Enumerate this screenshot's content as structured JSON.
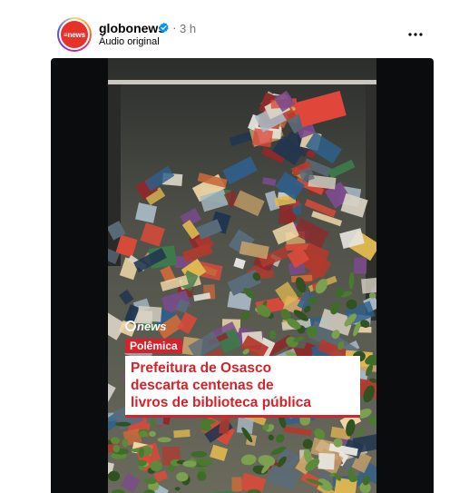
{
  "post": {
    "username": "globonews",
    "time_separator": "·",
    "time": "3 h",
    "audio_label": "Áudio original",
    "avatar_text": "≡news",
    "more_icon": "more-horizontal-icon",
    "verified_icon": "verified-badge-icon"
  },
  "video": {
    "brand_logo": "news",
    "tag": "Polêmica",
    "headline": "Prefeitura de Osasco\ndescarta centenas de\nlivros de biblioteca pública"
  },
  "colors": {
    "brand_red": "#d6222b",
    "verified_blue": "#0095f6",
    "frame_dark": "#0b0c0d"
  }
}
